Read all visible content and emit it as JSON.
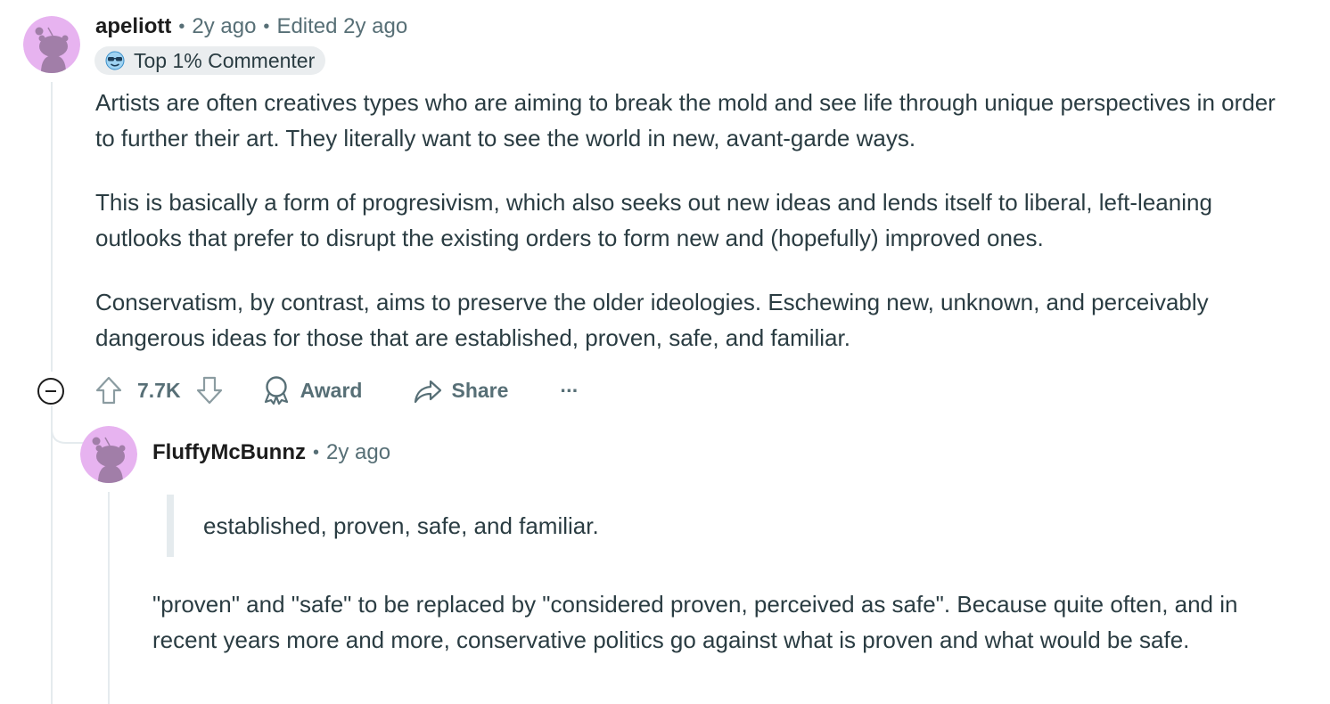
{
  "comment": {
    "author": "apeliott",
    "time": "2y ago",
    "edited": "Edited 2y ago",
    "badge": "Top 1% Commenter",
    "badge_icon": "sunglasses-emoji-icon",
    "paragraphs": [
      "Artists are often creatives types who are aiming to break the mold and see life through unique perspectives in order to further their art. They literally want to see the world in new, avant-garde ways.",
      "This is basically a form of progresivism, which also seeks out new ideas and lends itself to liberal, left-leaning outlooks that prefer to disrupt the existing orders to form new and (hopefully) improved ones.",
      "Conservatism, by contrast, aims to preserve the older ideologies. Eschewing new, unknown, and perceivably dangerous ideas for those that are established, proven, safe, and familiar."
    ],
    "score": "7.7K",
    "award_label": "Award",
    "share_label": "Share",
    "more_label": "···"
  },
  "reply": {
    "author": "FluffyMcBunnz",
    "time": "2y ago",
    "quote": "established, proven, safe, and familiar.",
    "body": "\"proven\" and \"safe\" to be replaced by \"considered proven, perceived as safe\". Because quite often, and in recent years more and more, conservative politics go against what is proven and what would be safe."
  },
  "colors": {
    "avatar_bg": "#e7b3f0",
    "avatar_figure": "#a17ea8",
    "thread_line": "#e5ebee",
    "muted_text": "#576f76",
    "body_text": "#2a3c42"
  }
}
